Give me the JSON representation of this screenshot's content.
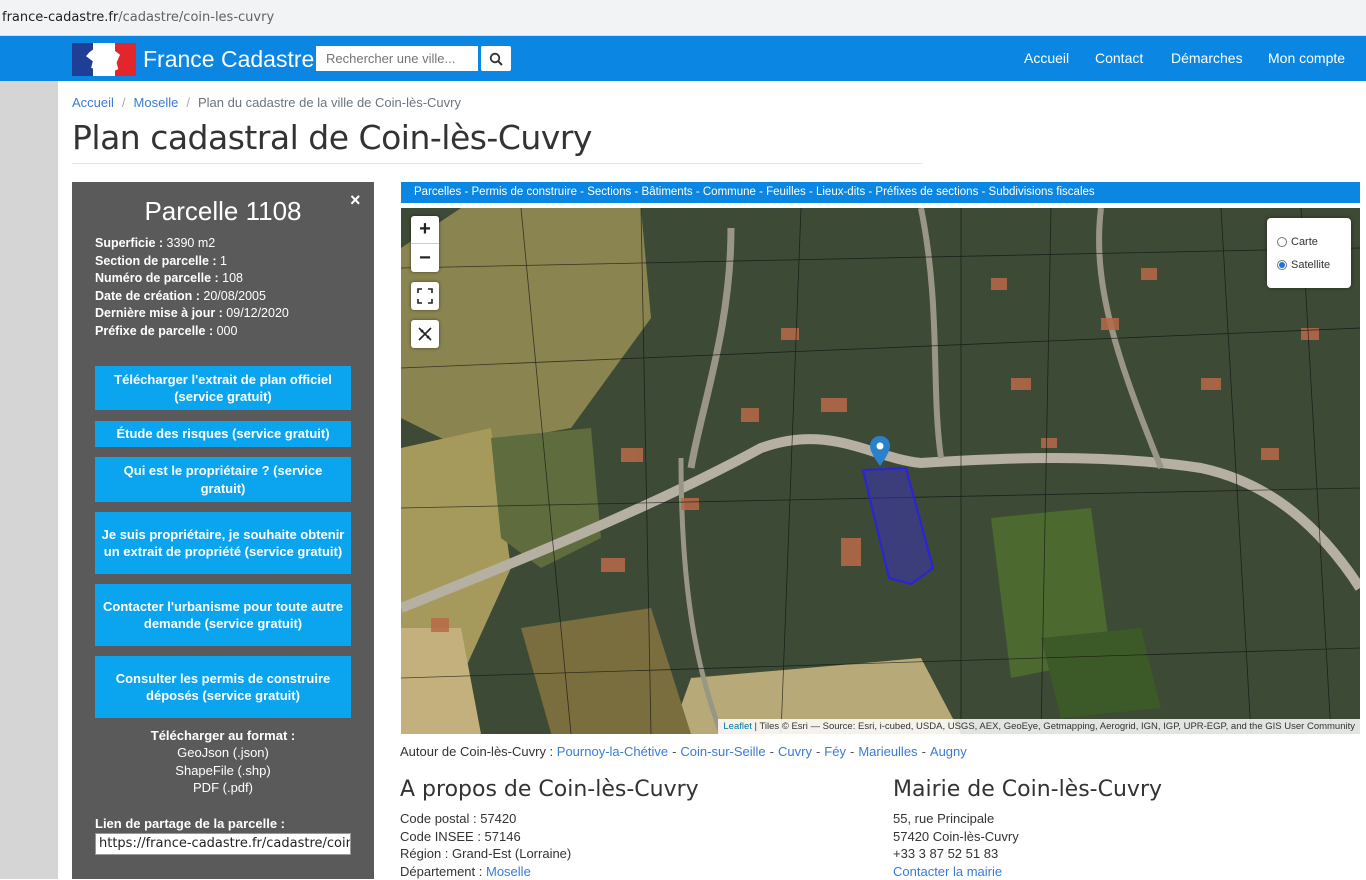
{
  "browser": {
    "url_host": "france-cadastre.fr",
    "url_path": "/cadastre/coin-les-cuvry"
  },
  "navbar": {
    "brand": "France Cadastre",
    "search_placeholder": "Rechercher une ville...",
    "links": [
      "Accueil",
      "Contact",
      "Démarches",
      "Mon compte"
    ]
  },
  "breadcrumb": {
    "home": "Accueil",
    "region": "Moselle",
    "current": "Plan du cadastre de la ville de Coin-lès-Cuvry"
  },
  "page_title": "Plan cadastral de Coin-lès-Cuvry",
  "parcel": {
    "title": "Parcelle 1108",
    "close": "×",
    "props": [
      {
        "label": "Superficie :",
        "value": " 3390 m2"
      },
      {
        "label": "Section de parcelle :",
        "value": " 1"
      },
      {
        "label": "Numéro de parcelle :",
        "value": " 108"
      },
      {
        "label": "Date de création :",
        "value": " 20/08/2005"
      },
      {
        "label": "Dernière mise à jour :",
        "value": " 09/12/2020"
      },
      {
        "label": "Préfixe de parcelle :",
        "value": " 000"
      }
    ],
    "buttons": [
      "Télécharger l'extrait de plan officiel (service gratuit)",
      "Étude des risques (service gratuit)",
      "Qui est le propriétaire ? (service gratuit)",
      "Je suis propriétaire, je souhaite obtenir un extrait de propriété (service gratuit)",
      "Contacter l'urbanisme pour toute autre demande (service gratuit)",
      "Consulter les permis de construire déposés (service gratuit)"
    ],
    "download_title": "Télécharger au format :",
    "download_formats": [
      "GeoJson (.json)",
      "ShapeFile (.shp)",
      "PDF (.pdf)"
    ],
    "share_label": "Lien de partage de la parcelle :",
    "share_value": "https://france-cadastre.fr/cadastre/coin-les-cuvry"
  },
  "layerbar": "Parcelles - Permis de construire - Sections - Bâtiments - Commune - Feuilles - Lieux-dits - Préfixes de sections - Subdivisions fiscales",
  "map": {
    "zoom_in": "+",
    "zoom_out": "−",
    "layers": [
      {
        "label": "Carte",
        "selected": false
      },
      {
        "label": "Satellite",
        "selected": true
      }
    ],
    "attribution_link": "Leaflet",
    "attribution_text": " | Tiles © Esri — Source: Esri, i-cubed, USDA, USGS, AEX, GeoEye, Getmapping, Aerogrid, IGN, IGP, UPR-EGP, and the GIS User Community"
  },
  "nearby": {
    "label": "Autour de Coin-lès-Cuvry : ",
    "towns": [
      "Pournoy-la-Chétive",
      "Coin-sur-Seille",
      "Cuvry",
      "Féy",
      "Marieulles",
      "Augny"
    ]
  },
  "about": {
    "title": "A propos de Coin-lès-Cuvry",
    "lines": [
      "Code postal : 57420",
      "Code INSEE : 57146",
      "Région : Grand-Est (Lorraine)"
    ],
    "dept_label": "Département : ",
    "dept_link": "Moselle"
  },
  "mairie": {
    "title": "Mairie de Coin-lès-Cuvry",
    "lines": [
      "55, rue Principale",
      "57420 Coin-lès-Cuvry",
      "+33 3 87 52 51 83"
    ],
    "contact_link": "Contacter la mairie"
  }
}
